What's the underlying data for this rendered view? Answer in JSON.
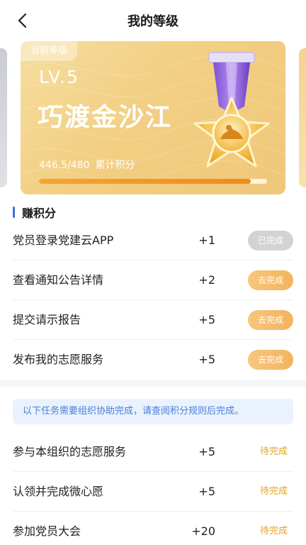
{
  "header": {
    "title": "我的等级"
  },
  "level_card": {
    "tag": "当前等级",
    "level": "LV.5",
    "name": "巧渡金沙江",
    "points_value": "446.5/480",
    "points_label": "累计积分",
    "progress": 0.93
  },
  "earn": {
    "title": "赚积分",
    "tasks": [
      {
        "name": "党员登录党建云APP",
        "points": "+1",
        "action": "已完成",
        "state": "done"
      },
      {
        "name": "查看通知公告详情",
        "points": "+2",
        "action": "去完成",
        "state": "todo"
      },
      {
        "name": "提交请示报告",
        "points": "+5",
        "action": "去完成",
        "state": "todo"
      },
      {
        "name": "发布我的志愿服务",
        "points": "+5",
        "action": "去完成",
        "state": "todo"
      }
    ]
  },
  "org": {
    "notice": "以下任务需要组织协助完成，请查阅积分规则后完成。",
    "tasks": [
      {
        "name": "参与本组织的志愿服务",
        "points": "+5",
        "status": "待完成"
      },
      {
        "name": "认领并完成微心愿",
        "points": "+5",
        "status": "待完成"
      },
      {
        "name": "参加党员大会",
        "points": "+20",
        "status": "待完成"
      }
    ]
  },
  "colors": {
    "accent_blue": "#3b6fe0",
    "gold": "#f0c77a",
    "orange_button": "#f4b35c",
    "pending_text": "#e5a21f"
  }
}
